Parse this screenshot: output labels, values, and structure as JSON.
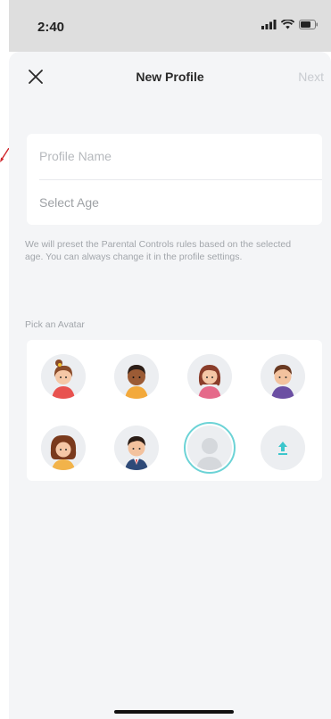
{
  "status": {
    "time": "2:40"
  },
  "header": {
    "title": "New Profile",
    "next_label": "Next"
  },
  "form": {
    "profile_name_placeholder": "Profile Name",
    "select_age_label": "Select Age"
  },
  "helper_text": "We will preset the Parental Controls rules based on the selected age. You can always change it in the profile settings.",
  "avatars": {
    "label": "Pick an Avatar",
    "items": [
      {
        "name": "girl-bun-avatar"
      },
      {
        "name": "boy-dark-skin-avatar"
      },
      {
        "name": "girl-pigtails-avatar"
      },
      {
        "name": "boy-purple-shirt-avatar"
      },
      {
        "name": "girl-curly-hair-avatar"
      },
      {
        "name": "boy-suit-avatar"
      },
      {
        "name": "default-gray-avatar",
        "selected": true
      },
      {
        "name": "upload-icon"
      }
    ]
  },
  "colors": {
    "accent": "#6cd3d6",
    "background": "#f4f5f7",
    "text_muted": "#b6b9bd"
  }
}
